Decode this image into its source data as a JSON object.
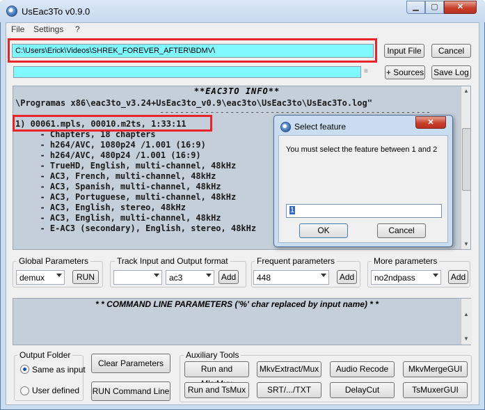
{
  "window": {
    "title": "UsEac3To v0.9.0",
    "min": "▁",
    "max": "▢",
    "close": "✕"
  },
  "menu": [
    "File",
    "Settings",
    "?"
  ],
  "input": {
    "path": "C:\\Users\\Erick\\Videos\\SHREK_FOREVER_AFTER\\BDMV\\",
    "input_file_label": "Input File",
    "cancel_label": "Cancel",
    "output_path": "",
    "sources_label": "+ Sources",
    "save_log_label": "Save Log"
  },
  "info": {
    "header": "**EAC3TO INFO**",
    "log_line": "\\Programas x86\\eac3to_v3.24+UsEac3to_v0.9\\eac3to\\UsEac3to\\UsEac3To.log\"",
    "dashes": "------------------------------------------------------",
    "playlist": "1) 00061.mpls, 00010.m2ts, 1:33:11",
    "tracks": [
      "  - Chapters, 18 chapters",
      "  - h264/AVC, 1080p24 /1.001 (16:9)",
      "  - h264/AVC, 480p24 /1.001 (16:9)",
      "  - TrueHD, English, multi-channel, 48kHz",
      "  - AC3, French, multi-channel, 48kHz",
      "  - AC3, Spanish, multi-channel, 48kHz",
      "  - AC3, Portuguese, multi-channel, 48kHz",
      "  - AC3, English, stereo, 48kHz",
      "  - AC3, English, multi-channel, 48kHz",
      "  - E-AC3 (secondary), English, stereo, 48kHz"
    ]
  },
  "global": {
    "title": "Global Parameters",
    "value": "demux",
    "run_label": "RUN"
  },
  "track": {
    "title": "Track Input and Output format",
    "input_value": "",
    "format_value": "ac3",
    "add_label": "Add"
  },
  "frequent": {
    "title": "Frequent parameters",
    "value": "448",
    "add_label": "Add"
  },
  "more": {
    "title": "More parameters",
    "value": "no2ndpass",
    "add_label": "Add"
  },
  "cmdline": {
    "header": "* * COMMAND LINE PARAMETERS ('%' char replaced by input name) * *",
    "value": ""
  },
  "output_folder": {
    "title": "Output Folder",
    "same_as_input": "Same as input",
    "user_defined": "User defined"
  },
  "buttons": {
    "clear_parameters": "Clear Parameters",
    "run_command_line": "RUN Command Line"
  },
  "aux": {
    "title": "Auxiliary Tools",
    "run_mkvmux": "Run and MkvMux",
    "mkvextract": "MkvExtract/Mux",
    "audio_recode": "Audio Recode",
    "mkvmergegui": "MkvMergeGUI",
    "run_tsmux": "Run and TsMux",
    "srt": "SRT/.../TXT",
    "delaycut": "DelayCut",
    "tsmuxergui": "TsMuxerGUI"
  },
  "dialog": {
    "title": "Select feature",
    "message": "You must select the feature between 1 and 2",
    "value": "1",
    "ok_label": "OK",
    "cancel_label": "Cancel"
  },
  "colors": {
    "accent": "#7ff9ff",
    "highlight": "#e8232a",
    "panel": "#c5cfd9"
  }
}
